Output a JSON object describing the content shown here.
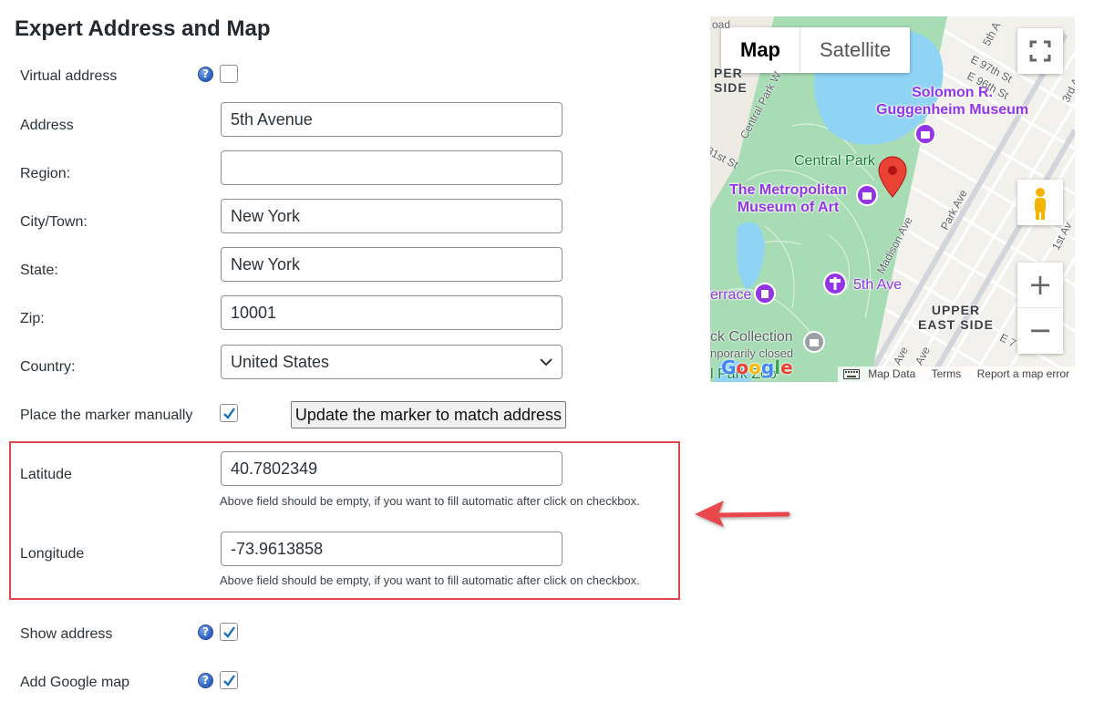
{
  "title": "Expert Address and Map",
  "form": {
    "virtual_address_label": "Virtual address",
    "address_label": "Address",
    "address_value": "5th Avenue",
    "region_label": "Region:",
    "region_value": "",
    "city_label": "City/Town:",
    "city_value": "New York",
    "state_label": "State:",
    "state_value": "New York",
    "zip_label": "Zip:",
    "zip_value": "10001",
    "country_label": "Country:",
    "country_value": "United States",
    "place_marker_label": "Place the marker manually",
    "update_marker_button": "Update the marker to match address",
    "latitude_label": "Latitude",
    "latitude_value": "40.7802349",
    "longitude_label": "Longitude",
    "longitude_value": "-73.9613858",
    "hint": "Above field should be empty, if you want to fill automatic after click on checkbox.",
    "show_address_label": "Show address",
    "add_google_map_label": "Add Google map",
    "help_glyph": "?",
    "checkboxes": {
      "virtual_address": false,
      "place_marker": true,
      "show_address": true,
      "add_google_map": true
    }
  },
  "map": {
    "tab_map": "Map",
    "tab_satellite": "Satellite",
    "poi_guggenheim": "Solomon R.\nGuggenheim Museum",
    "poi_met": "The Metropolitan\nMuseum of Art",
    "park_central": "Central Park",
    "poi_5th_ave": "5th Ave",
    "poi_terrace": "errace",
    "poi_collection": "ck Collection",
    "poi_closed": "nporarily closed",
    "poi_zoo": "l Park Zoo",
    "district_upper_east": "UPPER\nEAST SIDE",
    "district_west": "PER\nSIDE",
    "streets": {
      "central_park_w": "Central Park W",
      "s81": "81st St",
      "madison": "Madison Ave",
      "park_ave": "Park Ave",
      "e97": "E 97th St",
      "e96": "E 96th St",
      "fifth": "5th A",
      "third": "3rd A",
      "first": "1st Av",
      "madison2": "Ave",
      "ave3": "Ave",
      "e7": "E 7",
      "oad": "oad"
    },
    "google": "Google",
    "map_data": "Map Data",
    "terms": "Terms",
    "report": "Report a map error",
    "zoom_in": "+",
    "zoom_out": "−",
    "colors": {
      "water": "#8fd3f5",
      "park": "#a8dcb4",
      "marker": "#ea4335",
      "poi": "#9334e6"
    }
  }
}
